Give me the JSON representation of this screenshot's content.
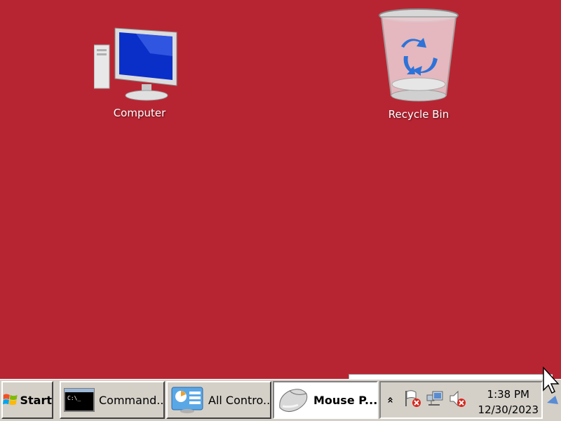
{
  "desktop": {
    "background_color": "#b82532",
    "icons": [
      {
        "label": "Computer",
        "icon": "computer-icon"
      },
      {
        "label": "Recycle Bin",
        "icon": "recycle-bin-icon"
      }
    ]
  },
  "taskbar": {
    "start_label": "Start",
    "buttons": [
      {
        "label": "Command...",
        "icon": "command-prompt-icon",
        "active": false
      },
      {
        "label": "All Contro...",
        "icon": "control-panel-icon",
        "active": false
      },
      {
        "label": "Mouse P...",
        "icon": "mouse-icon",
        "active": true
      }
    ],
    "tray": {
      "expand_glyph": "»",
      "icons": [
        "action-center-flag-icon",
        "network-icon",
        "volume-muted-icon"
      ],
      "time": "1:38 PM",
      "date": "12/30/2023"
    }
  }
}
